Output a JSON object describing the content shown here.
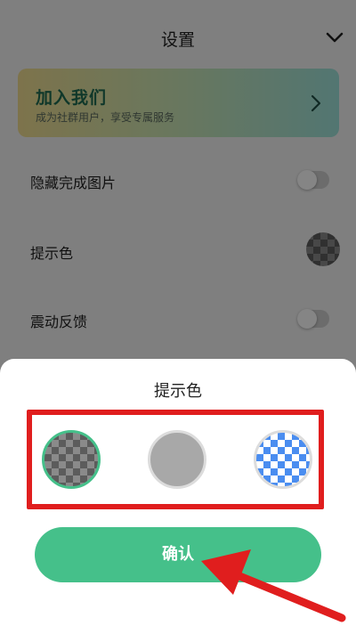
{
  "page": {
    "title": "设置",
    "collapse_icon": "chevron-down-icon"
  },
  "promo": {
    "title": "加入我们",
    "subtitle": "成为社群用户，享受专属服务",
    "chevron_icon": "chevron-right-icon",
    "gradient_colors": [
      "#f0dd91",
      "#cde5b2",
      "#9ee2da"
    ]
  },
  "settings": {
    "hide_completed": {
      "label": "隐藏完成图片",
      "enabled": false
    },
    "hint_color": {
      "label": "提示色",
      "swatch": "gray-checker"
    },
    "vibration": {
      "label": "震动反馈",
      "enabled": false
    }
  },
  "dialog": {
    "title": "提示色",
    "options": [
      {
        "name": "gray-checker",
        "selected": true
      },
      {
        "name": "solid-gray",
        "selected": false
      },
      {
        "name": "blue-checker",
        "selected": false
      }
    ],
    "confirm_label": "确认"
  },
  "colors": {
    "accent": "#45c08a",
    "highlight": "#e01e1e",
    "overlay": "rgba(0,0,0,0.48)"
  }
}
